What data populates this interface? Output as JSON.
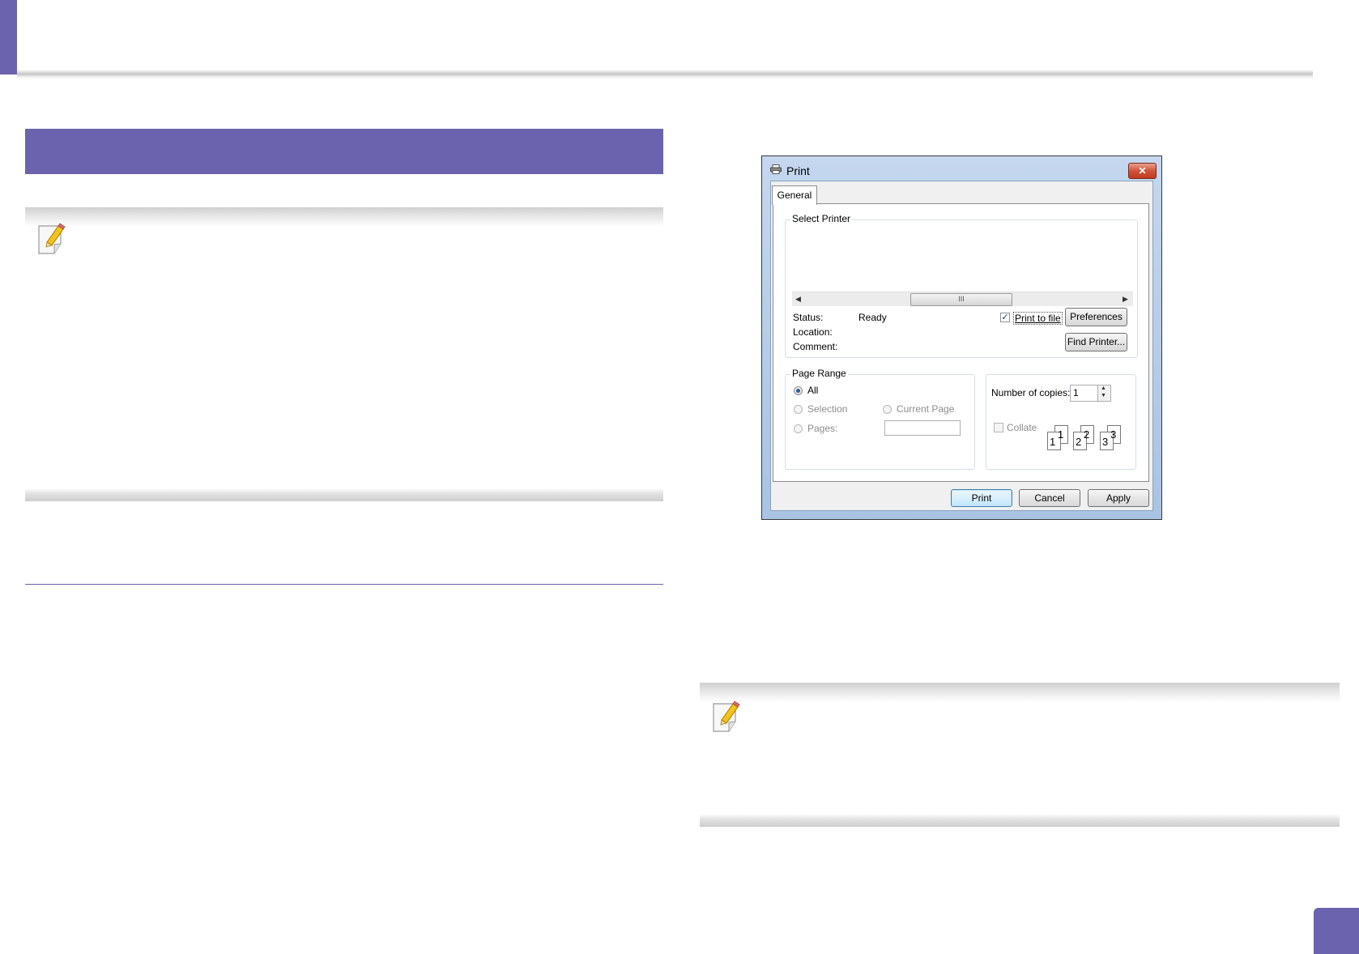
{
  "page": {
    "colors": {
      "accent": "#6b63ad"
    },
    "icons": [
      "note-pencil-icon",
      "printer-icon",
      "close-icon",
      "scroll-left-arrow-icon",
      "scroll-right-arrow-icon",
      "collate-pages-icon"
    ]
  },
  "dialog": {
    "title": "Print",
    "close_label": "✕",
    "tab_general": "General",
    "select_printer": {
      "legend": "Select Printer",
      "scroll_thumb": "III",
      "status_label": "Status:",
      "status_value": "Ready",
      "location_label": "Location:",
      "comment_label": "Comment:",
      "print_to_file_label": "Print to file",
      "print_to_file_checked": true,
      "preferences_label": "Preferences",
      "find_printer_label": "Find Printer..."
    },
    "page_range": {
      "legend": "Page Range",
      "all_label": "All",
      "selection_label": "Selection",
      "current_page_label": "Current Page",
      "pages_label": "Pages:",
      "pages_value": ""
    },
    "copies": {
      "number_label": "Number of copies:",
      "number_value": "1",
      "collate_label": "Collate",
      "collate_checked": false,
      "collate_digits": [
        "1",
        "1",
        "2",
        "2",
        "3",
        "3"
      ]
    },
    "buttons": {
      "print": "Print",
      "cancel": "Cancel",
      "apply": "Apply"
    }
  }
}
